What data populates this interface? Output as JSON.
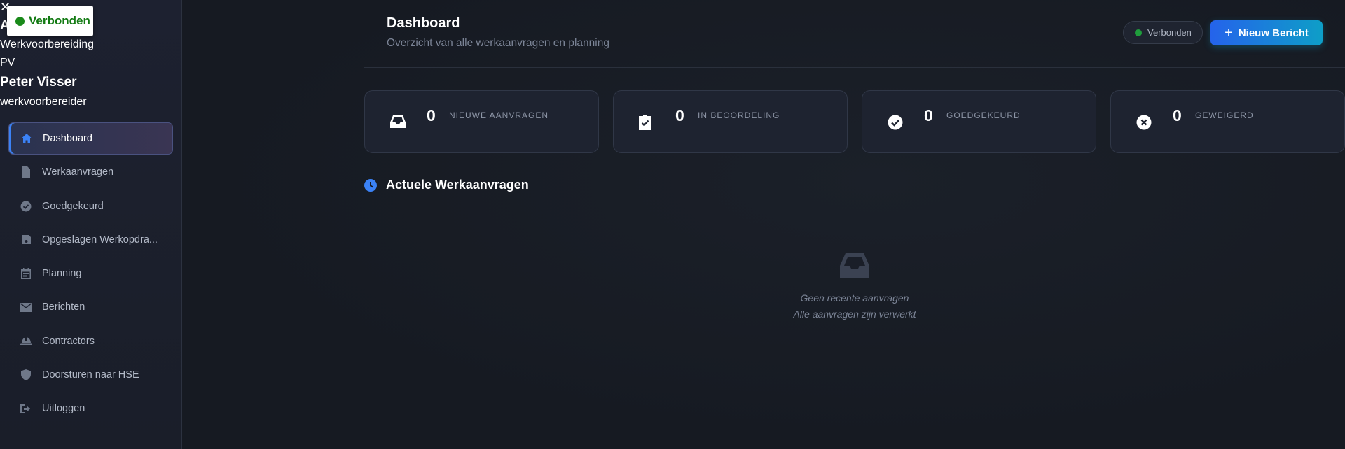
{
  "connection": {
    "label": "Verbonden",
    "color": "#127a12"
  },
  "user": {
    "initial_heading": "A",
    "department": "Werkvoorbereiding",
    "initials": "PV",
    "name": "Peter Visser",
    "role": "werkvoorbereider"
  },
  "sidebar": {
    "items": [
      {
        "label": "Dashboard",
        "icon": "home-icon",
        "active": true
      },
      {
        "label": "Werkaanvragen",
        "icon": "file-icon"
      },
      {
        "label": "Goedgekeurd",
        "icon": "check-circle-icon"
      },
      {
        "label": "Opgeslagen Werkopdra...",
        "icon": "save-icon"
      },
      {
        "label": "Planning",
        "icon": "calendar-icon"
      },
      {
        "label": "Berichten",
        "icon": "envelope-icon"
      },
      {
        "label": "Contractors",
        "icon": "hard-hat-icon"
      },
      {
        "label": "Doorsturen naar HSE",
        "icon": "shield-icon"
      },
      {
        "label": "Uitloggen",
        "icon": "logout-icon"
      }
    ]
  },
  "header": {
    "title": "Dashboard",
    "subtitle": "Overzicht van alle werkaanvragen en planning",
    "status": "Verbonden",
    "new_button": "Nieuw Bericht"
  },
  "stats": [
    {
      "value": "0",
      "label": "NIEUWE AANVRAGEN",
      "icon": "inbox-icon"
    },
    {
      "value": "0",
      "label": "IN BEOORDELING",
      "icon": "clipboard-check-icon"
    },
    {
      "value": "0",
      "label": "GOEDGEKEURD",
      "icon": "check-circle-icon"
    },
    {
      "value": "0",
      "label": "GEWEIGERD",
      "icon": "x-circle-icon"
    }
  ],
  "section": {
    "title": "Actuele Werkaanvragen",
    "empty_title": "Geen recente aanvragen",
    "empty_sub": "Alle aanvragen zijn verwerkt"
  }
}
